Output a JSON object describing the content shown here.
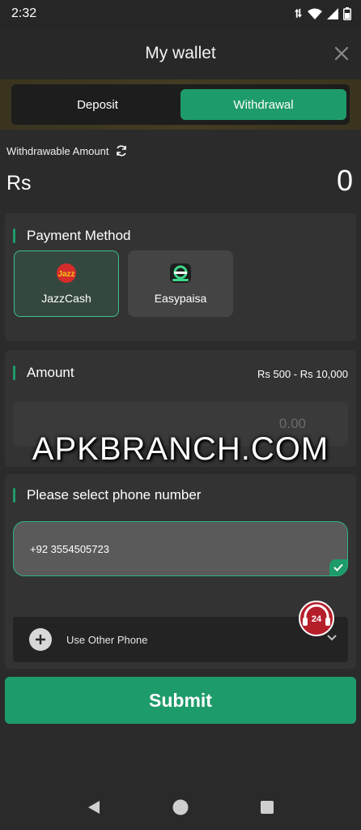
{
  "status_bar": {
    "time": "2:32"
  },
  "header": {
    "title": "My wallet",
    "close_icon": "close-icon"
  },
  "tabs": [
    {
      "label": "Deposit",
      "active": false
    },
    {
      "label": "Withdrawal",
      "active": true
    }
  ],
  "balance": {
    "label": "Withdrawable Amount",
    "currency": "Rs",
    "value": "0"
  },
  "payment": {
    "title": "Payment Method",
    "methods": [
      {
        "label": "JazzCash",
        "selected": true,
        "icon": "jazz-logo",
        "logo_text": "Jazz"
      },
      {
        "label": "Easypaisa",
        "selected": false,
        "icon": "easypaisa-logo"
      }
    ]
  },
  "amount": {
    "title": "Amount",
    "range": "Rs 500 - Rs 10,000",
    "placeholder": "0.00"
  },
  "phone": {
    "title": "Please select phone number",
    "selected_number": "+92 3554505723",
    "other_label": "Use Other Phone"
  },
  "support": {
    "badge": "24"
  },
  "submit_label": "Submit",
  "watermark": "APKBRANCH.COM",
  "colors": {
    "accent": "#1e9b6b",
    "background": "#2b2b2b",
    "card": "#333333",
    "tab_strip": "#433b22"
  }
}
